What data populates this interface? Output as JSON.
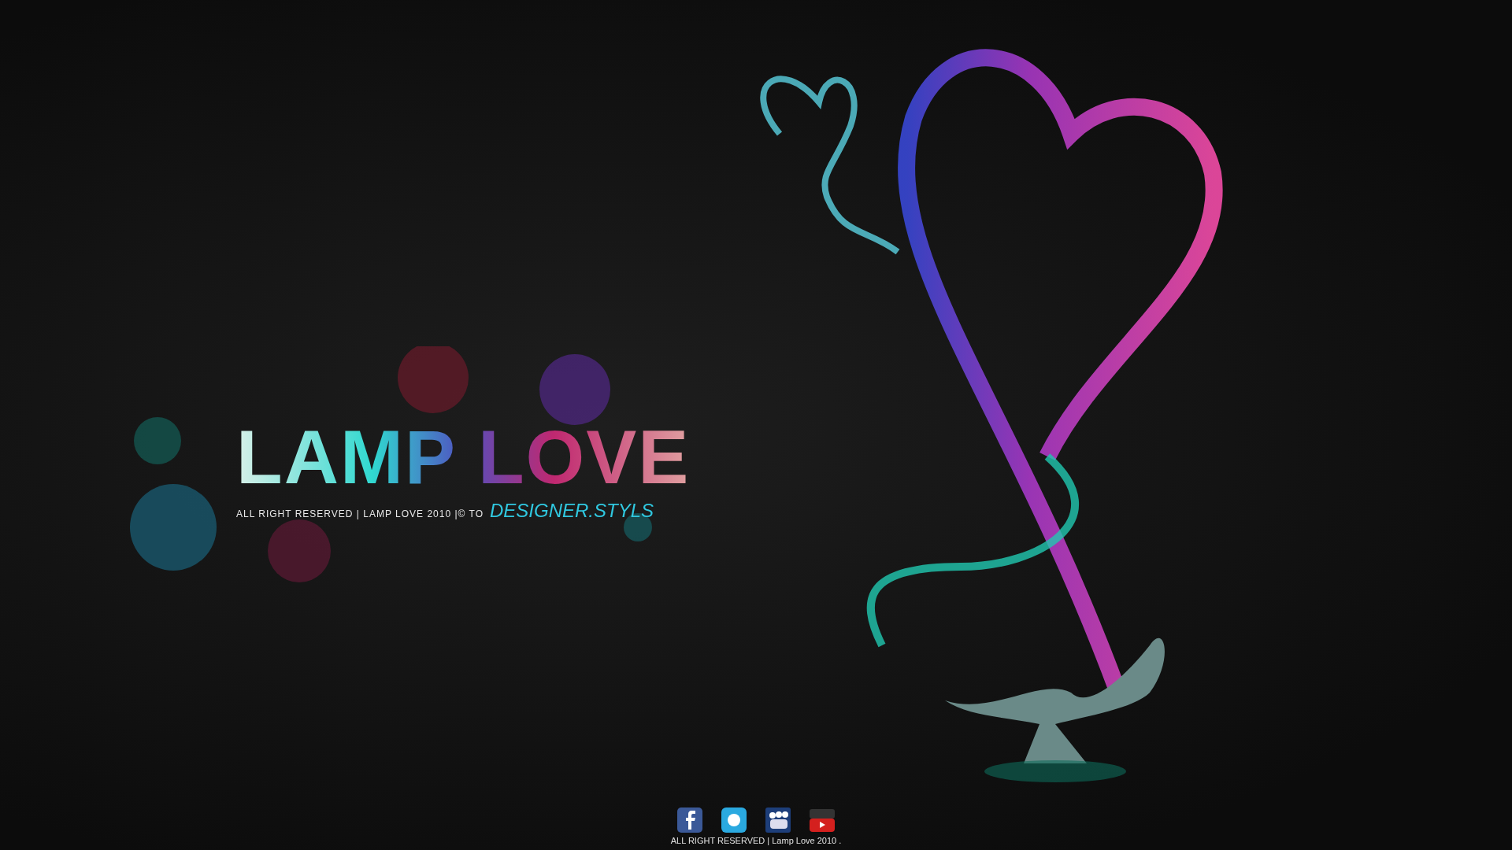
{
  "logo": {
    "title": "LAMP LOVE",
    "tagline": "ALL RIGHT RESERVED | LAMP LOVE 2010 |© TO",
    "designer": "DESIGNER.STYLS"
  },
  "footer": {
    "social_links": [
      {
        "kind": "facebook"
      },
      {
        "kind": "twitter"
      },
      {
        "kind": "myspace"
      },
      {
        "kind": "youtube"
      }
    ],
    "copyright": "ALL RIGHT RESERVED | Lamp Love 2010 ."
  }
}
